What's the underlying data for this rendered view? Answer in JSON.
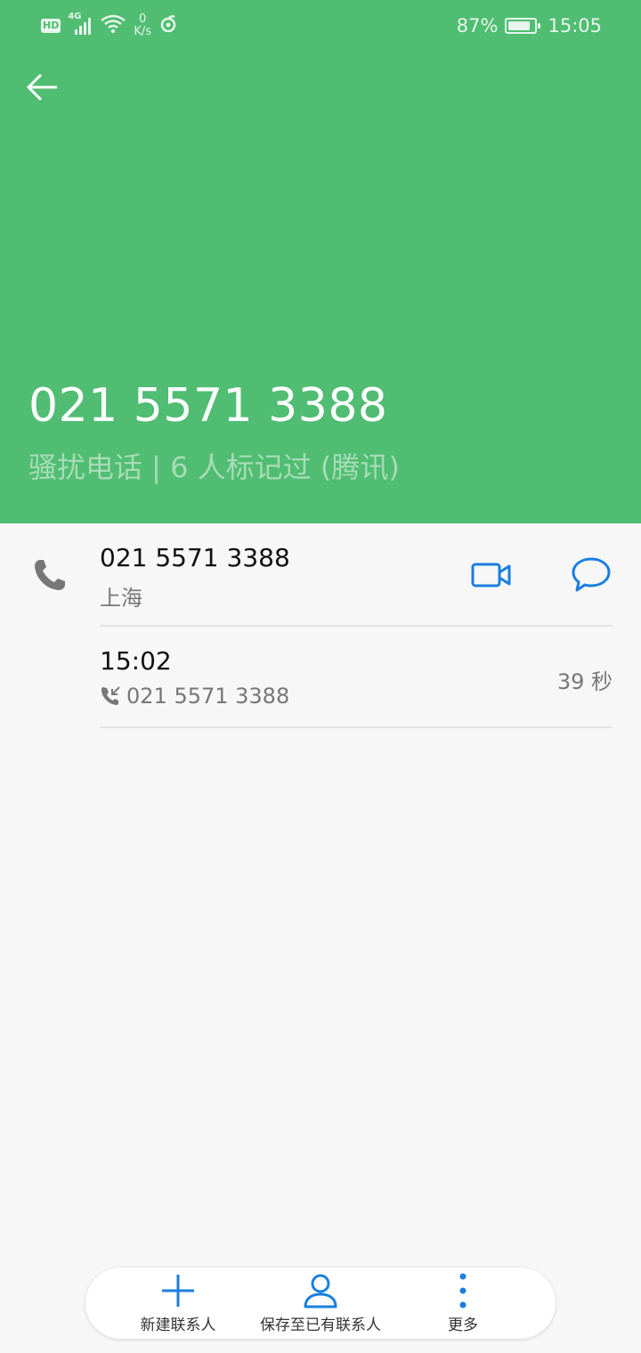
{
  "colors": {
    "header_bg": "#50bd72",
    "accent": "#1a7fe0",
    "page_bg": "#f7f7f7"
  },
  "status_bar": {
    "badge": "HD",
    "network": "4G",
    "net_speed_value": "0",
    "net_speed_unit": "K/s",
    "battery_percent": "87%",
    "battery_level": 0.87,
    "time": "15:05",
    "icons": [
      "signal-icon",
      "wifi-icon",
      "nfc-icon",
      "battery-icon"
    ]
  },
  "header": {
    "back_icon": "arrow-left-icon",
    "number": "021 5571 3388",
    "tag_info": "骚扰电话 | 6 人标记过 (腾讯)"
  },
  "contact_row": {
    "icon": "phone-icon",
    "number": "021 5571 3388",
    "location": "上海",
    "actions": [
      "video-call-icon",
      "message-icon"
    ]
  },
  "call_log": [
    {
      "time": "15:02",
      "type_icon": "incoming-call-icon",
      "number": "021 5571 3388",
      "duration": "39 秒"
    }
  ],
  "bottom_bar": {
    "items": [
      {
        "icon": "plus-icon",
        "label": "新建联系人"
      },
      {
        "icon": "person-icon",
        "label": "保存至已有联系人"
      },
      {
        "icon": "more-vertical-icon",
        "label": "更多"
      }
    ]
  }
}
